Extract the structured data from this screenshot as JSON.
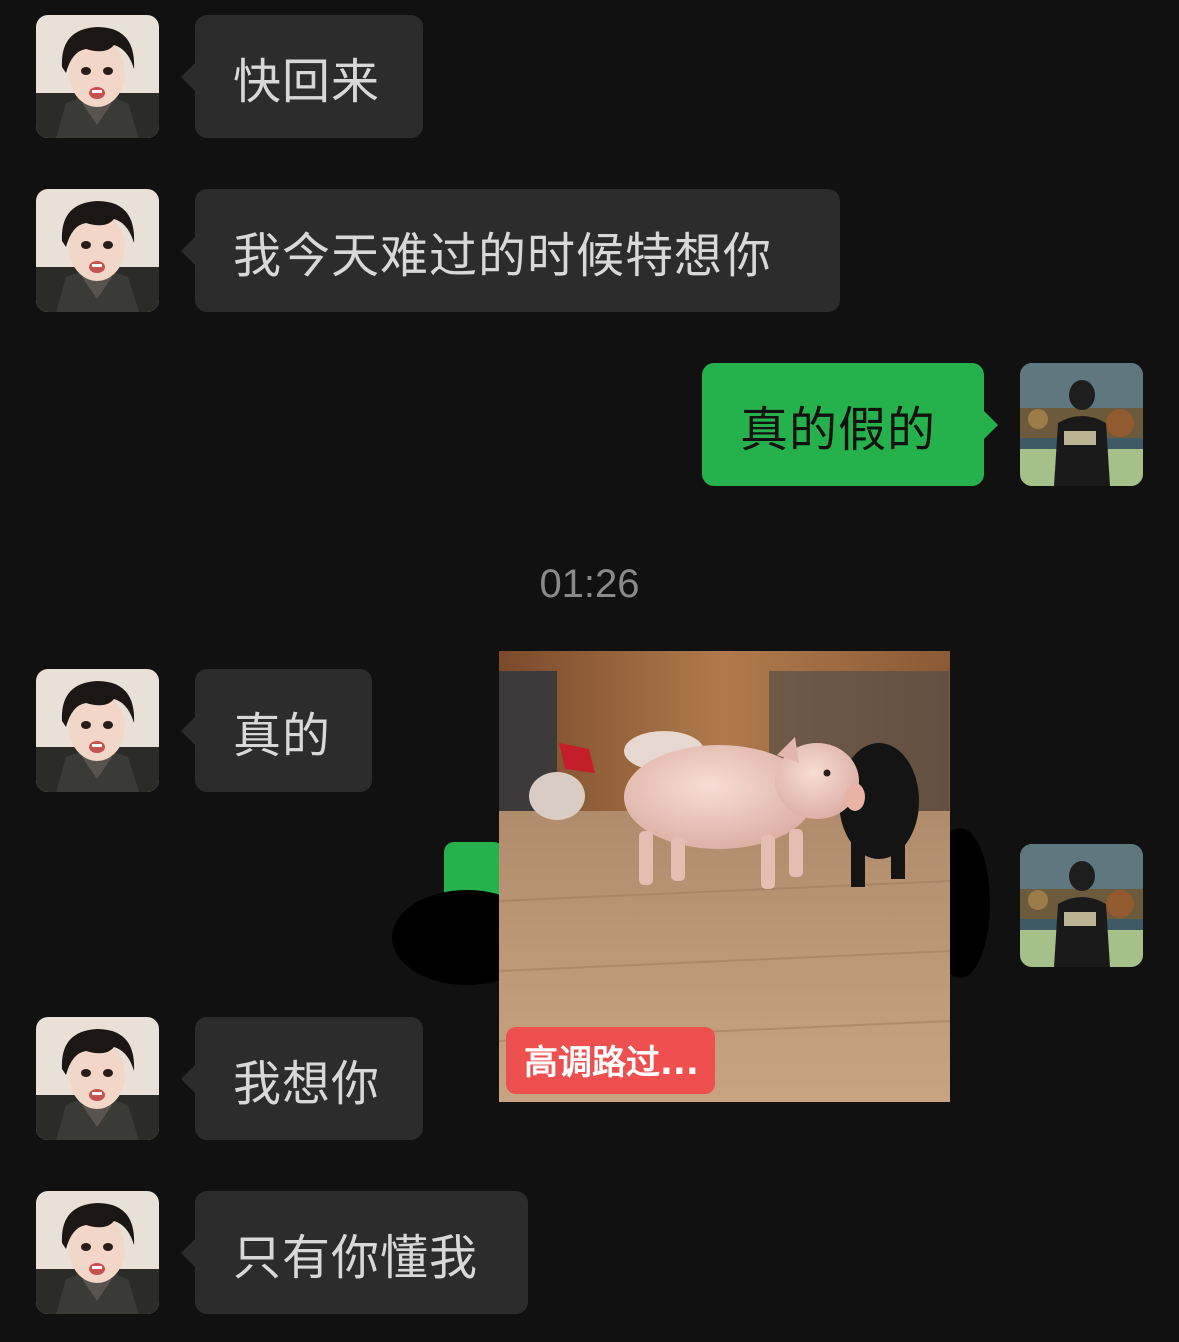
{
  "timestamp": "01:26",
  "messages": [
    {
      "side": "in",
      "text": "快回来"
    },
    {
      "side": "in",
      "text": "我今天难过的时候特想你"
    },
    {
      "side": "out",
      "text": "真的假的"
    },
    {
      "side": "in",
      "text": "真的"
    },
    {
      "side": "out",
      "type": "sticker",
      "caption": "高调路过..."
    },
    {
      "side": "in",
      "text": "我想你"
    },
    {
      "side": "in",
      "text": "只有你懂我"
    }
  ],
  "avatars": {
    "contact": "contact-avatar-icon",
    "self": "self-avatar-icon"
  },
  "colors": {
    "background": "#111111",
    "incoming_bubble": "#2c2c2c",
    "outgoing_bubble": "#25b24d",
    "caption_badge": "#ee5050"
  }
}
